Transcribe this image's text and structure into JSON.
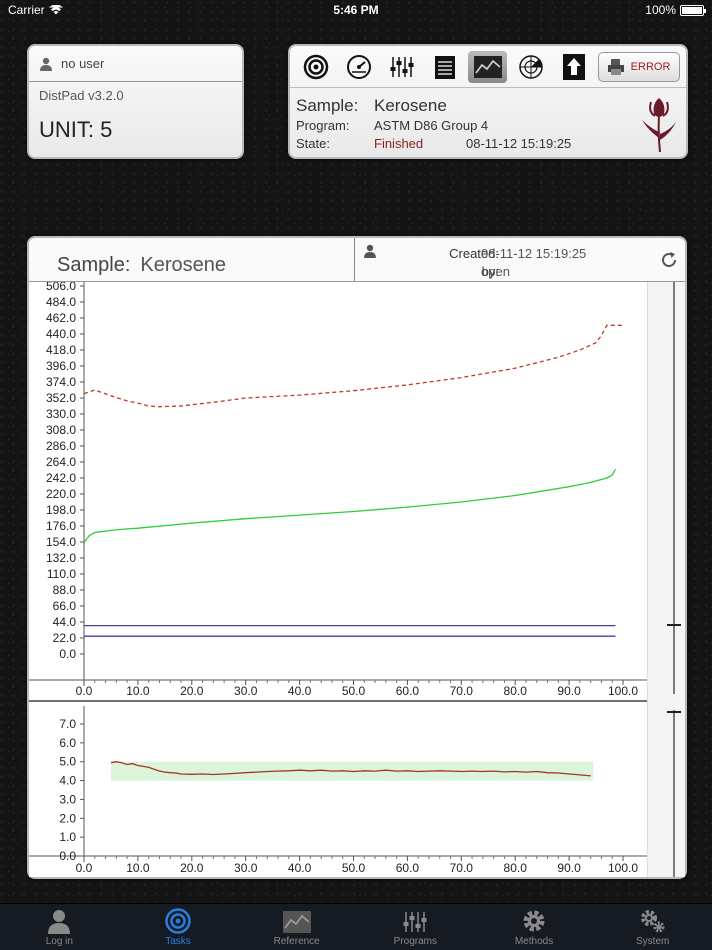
{
  "status_bar": {
    "carrier": "Carrier",
    "time": "5:46 PM",
    "battery": "100%",
    "battery_level": 1.0
  },
  "user_panel": {
    "user": "no user",
    "version": "DistPad v3.2.0",
    "unit": "UNIT: 5"
  },
  "toolbar": {
    "tools": [
      "target-icon",
      "gauge-icon",
      "sliders-icon",
      "notepad-icon",
      "chart-icon",
      "radar-icon",
      "upload-icon"
    ],
    "active_tool": "chart-icon",
    "error_label": "ERROR"
  },
  "run_info": {
    "sample_label": "Sample:",
    "sample": "Kerosene",
    "program_label": "Program:",
    "program": "ASTM D86 Group 4",
    "state_label": "State:",
    "state": "Finished",
    "timestamp": "08-11-12 15:19:25",
    "state_color": "#8b1d1d"
  },
  "main": {
    "sample_label": "Sample:",
    "sample": "Kerosene",
    "created_label": "Created:",
    "created": "08-11-12 15:19:25",
    "by_label": "by:",
    "by": "open"
  },
  "chart_data": [
    {
      "type": "line",
      "x_ticks": [
        "0.0",
        "10.0",
        "20.0",
        "30.0",
        "40.0",
        "50.0",
        "60.0",
        "70.0",
        "80.0",
        "90.0",
        "100.0"
      ],
      "y_ticks": [
        "506.0",
        "484.0",
        "462.0",
        "440.0",
        "418.0",
        "396.0",
        "374.0",
        "352.0",
        "330.0",
        "308.0",
        "286.0",
        "264.0",
        "242.0",
        "220.0",
        "198.0",
        "176.0",
        "154.0",
        "132.0",
        "110.0",
        "88.0",
        "66.0",
        "44.0",
        "22.0",
        "0.0"
      ],
      "xlim": [
        0,
        100
      ],
      "ylim": [
        0,
        506
      ],
      "series": [
        {
          "color": "#c0392b",
          "dash": true,
          "x": [
            0,
            2,
            5,
            8,
            10,
            12,
            14,
            18,
            25,
            30,
            40,
            50,
            60,
            70,
            80,
            88,
            92,
            95,
            96,
            97,
            98,
            100
          ],
          "y": [
            358,
            363,
            355,
            348,
            345,
            341,
            340,
            341,
            347,
            352,
            356,
            362,
            370,
            380,
            393,
            408,
            418,
            428,
            438,
            452,
            452,
            452
          ]
        },
        {
          "color": "#2ecc40",
          "x": [
            0,
            1,
            2,
            3,
            5,
            8,
            10,
            20,
            30,
            40,
            50,
            60,
            70,
            80,
            90,
            94,
            96,
            97,
            98,
            98.6
          ],
          "y": [
            153,
            163,
            167,
            168,
            170,
            172,
            173,
            180,
            186,
            191,
            196,
            202,
            209,
            218,
            230,
            236,
            240,
            242,
            246,
            254
          ]
        },
        {
          "color": "#4b3fa0",
          "x": [
            0,
            98.6
          ],
          "y": [
            39,
            39
          ]
        },
        {
          "color": "#4b3fa0",
          "x": [
            0,
            98.6
          ],
          "y": [
            24.5,
            24.5
          ]
        }
      ]
    },
    {
      "type": "line",
      "x_ticks": [
        "0.0",
        "10.0",
        "20.0",
        "30.0",
        "40.0",
        "50.0",
        "60.0",
        "70.0",
        "80.0",
        "90.0",
        "100.0"
      ],
      "y_ticks": [
        "7.0",
        "6.0",
        "5.0",
        "4.0",
        "3.0",
        "2.0",
        "1.0",
        "0.0"
      ],
      "xlim": [
        0,
        100
      ],
      "ylim": [
        0,
        7
      ],
      "band": {
        "x": [
          5,
          94.5
        ],
        "y": [
          4.0,
          5.0
        ],
        "color": "#dbf5db"
      },
      "series": [
        {
          "color": "#a93226",
          "x": [
            5,
            6,
            7,
            8,
            9,
            10,
            11,
            12,
            13,
            14,
            15,
            16,
            17,
            18,
            20,
            22,
            24,
            26,
            28,
            30,
            32,
            34,
            36,
            38,
            40,
            42,
            44,
            46,
            48,
            50,
            52,
            54,
            56,
            58,
            60,
            62,
            64,
            66,
            68,
            70,
            72,
            74,
            76,
            78,
            80,
            82,
            84,
            86,
            88,
            90,
            92,
            94
          ],
          "y": [
            4.95,
            5.0,
            4.95,
            4.85,
            4.9,
            4.8,
            4.75,
            4.7,
            4.6,
            4.5,
            4.45,
            4.42,
            4.4,
            4.35,
            4.33,
            4.35,
            4.32,
            4.35,
            4.38,
            4.42,
            4.45,
            4.48,
            4.5,
            4.52,
            4.55,
            4.52,
            4.55,
            4.5,
            4.52,
            4.48,
            4.52,
            4.5,
            4.55,
            4.5,
            4.52,
            4.48,
            4.5,
            4.52,
            4.5,
            4.48,
            4.5,
            4.48,
            4.5,
            4.46,
            4.48,
            4.45,
            4.48,
            4.42,
            4.4,
            4.35,
            4.3,
            4.25
          ]
        }
      ]
    }
  ],
  "tabs": [
    {
      "label": "Log in",
      "icon": "person-icon"
    },
    {
      "label": "Tasks",
      "icon": "target-icon",
      "active": true
    },
    {
      "label": "Reference",
      "icon": "chart-icon"
    },
    {
      "label": "Programs",
      "icon": "sliders-icon"
    },
    {
      "label": "Methods",
      "icon": "gear-icon"
    },
    {
      "label": "System",
      "icon": "gears-icon"
    }
  ]
}
